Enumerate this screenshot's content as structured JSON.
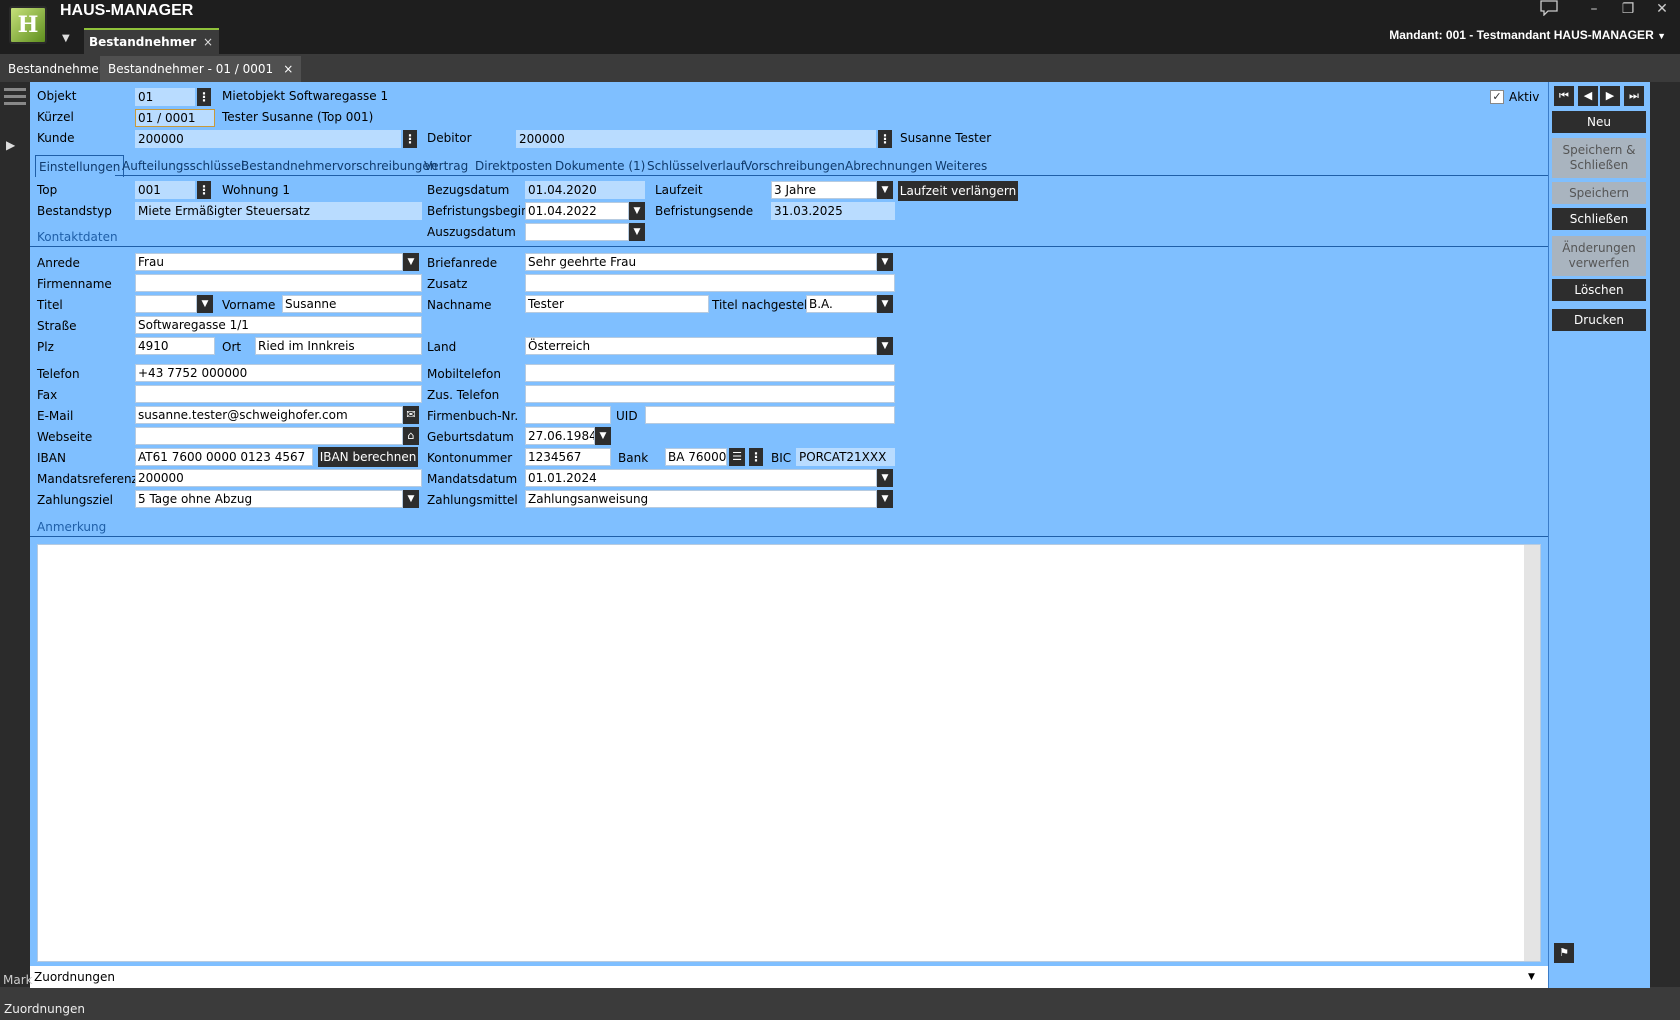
{
  "app": {
    "title": "HAUS-MANAGER",
    "logo_text": "H",
    "tab_label": "Bestandnehmer",
    "mandant": "Mandant: 001 - Testmandant HAUS-MANAGER"
  },
  "tabs2": [
    "Bestandnehmer",
    "Bestandnehmer - 01 / 0001"
  ],
  "header": {
    "objekt_label": "Objekt",
    "objekt_value": "01",
    "objekt_desc": "Mietobjekt Softwaregasse 1",
    "kuerzel_label": "Kürzel",
    "kuerzel_value": "01 / 0001",
    "kuerzel_desc": "Tester Susanne (Top 001)",
    "kunde_label": "Kunde",
    "kunde_value": "200000",
    "debitor_label": "Debitor",
    "debitor_value": "200000",
    "debitor_name": "Susanne Tester",
    "aktiv_label": "Aktiv"
  },
  "tabs": [
    "Einstellungen",
    "Aufteilungsschlüssel",
    "Bestandnehmervorschreibungen",
    "Vertrag",
    "Direktposten",
    "Dokumente (1)",
    "Schlüsselverlauf",
    "Vorschreibungen",
    "Abrechnungen",
    "Weiteres"
  ],
  "einst": {
    "top_label": "Top",
    "top_value": "001",
    "top_desc": "Wohnung 1",
    "bestandstyp_label": "Bestandstyp",
    "bestandstyp_value": "Miete Ermäßigter Steuersatz",
    "bezug_label": "Bezugsdatum",
    "bezug_value": "01.04.2020",
    "befbeginn_label": "Befristungsbeginn",
    "befbeginn_value": "01.04.2022",
    "auszug_label": "Auszugsdatum",
    "auszug_value": "",
    "laufzeit_label": "Laufzeit",
    "laufzeit_value": "3 Jahre",
    "laufzeit_btn": "Laufzeit verlängern",
    "befende_label": "Befristungsende",
    "befende_value": "31.03.2025"
  },
  "kontakt": {
    "section": "Kontaktdaten",
    "anrede_label": "Anrede",
    "anrede_value": "Frau",
    "brief_label": "Briefanrede",
    "brief_value": "Sehr geehrte Frau",
    "firma_label": "Firmenname",
    "firma_value": "",
    "zusatz_label": "Zusatz",
    "zusatz_value": "",
    "titel_label": "Titel",
    "titel_value": "",
    "vorname_label": "Vorname",
    "vorname_value": "Susanne",
    "nachname_label": "Nachname",
    "nachname_value": "Tester",
    "titelnach_label": "Titel nachgestellt",
    "titelnach_value": "B.A.",
    "strasse_label": "Straße",
    "strasse_value": "Softwaregasse 1/1",
    "plz_label": "Plz",
    "plz_value": "4910",
    "ort_label": "Ort",
    "ort_value": "Ried im Innkreis",
    "land_label": "Land",
    "land_value": "Österreich",
    "tel_label": "Telefon",
    "tel_value": "+43 7752 000000",
    "mobil_label": "Mobiltelefon",
    "mobil_value": "",
    "fax_label": "Fax",
    "fax_value": "",
    "zustel_label": "Zus. Telefon",
    "zustel_value": "",
    "email_label": "E-Mail",
    "email_value": "susanne.tester@schweighofer.com",
    "fbnr_label": "Firmenbuch-Nr.",
    "fbnr_value": "",
    "uid_label": "UID",
    "uid_value": "",
    "web_label": "Webseite",
    "web_value": "",
    "geb_label": "Geburtsdatum",
    "geb_value": "27.06.1984",
    "iban_label": "IBAN",
    "iban_value": "AT61 7600 0000 0123 4567",
    "iban_btn": "IBAN berechnen",
    "konto_label": "Kontonummer",
    "konto_value": "1234567",
    "bank_label": "Bank",
    "bank_value": "BA 76000",
    "bic_label": "BIC",
    "bic_value": "PORCAT21XXX",
    "mref_label": "Mandatsreferenz",
    "mref_value": "200000",
    "mdatum_label": "Mandatsdatum",
    "mdatum_value": "01.01.2024",
    "zziel_label": "Zahlungsziel",
    "zziel_value": "5 Tage ohne Abzug",
    "zmittel_label": "Zahlungsmittel",
    "zmittel_value": "Zahlungsanweisung"
  },
  "anmerkung": {
    "section": "Anmerkung",
    "text": ""
  },
  "zuordnungen": "Zuordnungen",
  "side": {
    "neu": "Neu",
    "speichern_schliessen": "Speichern & Schließen",
    "speichern": "Speichern",
    "schliessen": "Schließen",
    "aenderungen": "Änderungen verwerfen",
    "loeschen": "Löschen",
    "drucken": "Drucken"
  },
  "status": {
    "mark": "Mark",
    "zuordnungen": "Zuordnungen"
  }
}
